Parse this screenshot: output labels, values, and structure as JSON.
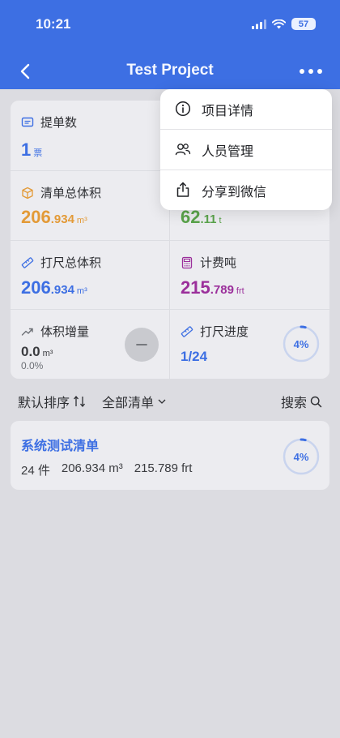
{
  "status": {
    "time": "10:21",
    "battery": "57"
  },
  "nav": {
    "title": "Test Project"
  },
  "stats": {
    "tickets": {
      "label": "提单数",
      "value": "1",
      "unit": "票"
    },
    "volume": {
      "label": "清单总体积",
      "int": "206",
      "dec": ".934",
      "unit": "m³"
    },
    "weight": {
      "int": "62",
      "dec": ".11",
      "unit": "t"
    },
    "measured_volume": {
      "label": "打尺总体积",
      "int": "206",
      "dec": ".934",
      "unit": "m³"
    },
    "freight_tons": {
      "label": "计费吨",
      "int": "215",
      "dec": ".789",
      "unit": "frt"
    },
    "growth": {
      "label": "体积增量",
      "value": "0.0",
      "unit": "m³",
      "percent": "0.0%"
    },
    "progress": {
      "label": "打尺进度",
      "value": "1/24",
      "percent_text": "4%",
      "fraction": 0.04
    }
  },
  "filters": {
    "sort": "默认排序",
    "scope": "全部清单",
    "search": "搜索"
  },
  "list": [
    {
      "title": "系统测试清单",
      "count": "24 件",
      "volume": "206.934 m³",
      "freight": "215.789 frt",
      "percent_text": "4%",
      "fraction": 0.04
    }
  ],
  "menu": {
    "items": [
      {
        "label": "项目详情",
        "icon": "info-icon"
      },
      {
        "label": "人员管理",
        "icon": "people-icon"
      },
      {
        "label": "分享到微信",
        "icon": "share-icon"
      }
    ]
  },
  "colors": {
    "brand": "#3d6fe3",
    "orange": "#e39a37",
    "green": "#5aa34b",
    "purple": "#9b2f9b"
  }
}
